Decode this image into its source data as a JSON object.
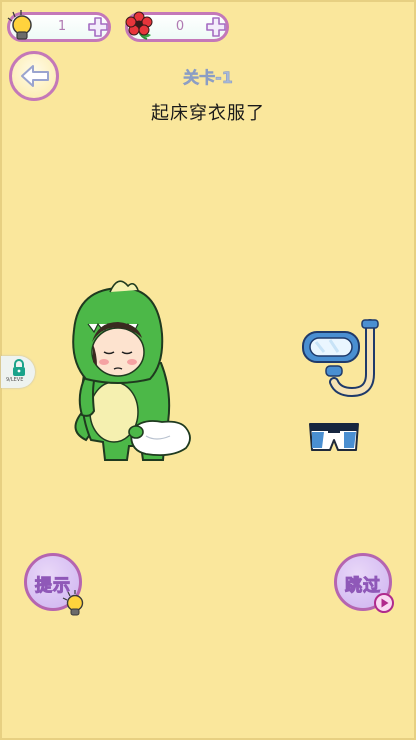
{
  "resources": {
    "hints": {
      "count": "1",
      "icon": "lightbulb-icon",
      "add_icon": "plus-icon"
    },
    "flowers": {
      "count": "0",
      "icon": "red-flower-icon",
      "add_icon": "plus-icon"
    }
  },
  "level": {
    "label": "关卡-1",
    "task": "起床穿衣服了"
  },
  "side_lock": {
    "icon": "lock-icon",
    "text": "9/LEVE"
  },
  "scene": {
    "character": "dinosaur-pajama-character",
    "items": [
      "snorkel-mask",
      "swim-trunks"
    ]
  },
  "buttons": {
    "hint_label": "提示",
    "skip_label": "跳过"
  },
  "colors": {
    "background": "#fae79c",
    "button_border": "#b565b0",
    "button_fill": "#cdb2f0",
    "dino_green": "#4cb848"
  }
}
